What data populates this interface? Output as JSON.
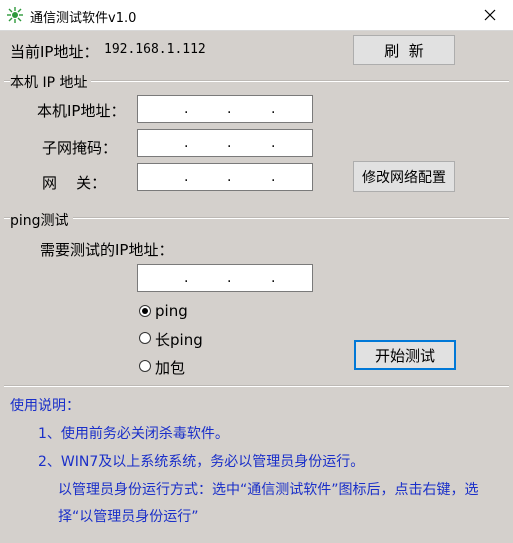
{
  "window": {
    "title": "通信测试软件v1.0",
    "icon": "network-icon"
  },
  "current_ip": {
    "label": "当前IP地址：",
    "value": "192.168.1.112",
    "refresh_label": "刷  新"
  },
  "local": {
    "section_title": "本机 IP 地址",
    "ip_label": "本机IP地址：",
    "mask_label": "子网掩码：",
    "gateway_label": "网    关：",
    "dot": ".",
    "modify_label": "修改网络配置"
  },
  "ping": {
    "section_title": "ping测试",
    "target_label": "需要测试的IP地址：",
    "options": [
      "ping",
      "长ping",
      "加包"
    ],
    "selected": "ping",
    "start_label": "开始测试"
  },
  "instructions": {
    "title": "使用说明：",
    "line1": "1、使用前务必关闭杀毒软件。",
    "line2": "2、WIN7及以上系统系统，务必以管理员身份运行。",
    "line3": "以管理员身份运行方式：选中“通信测试软件”图标后，点击右键，选",
    "line4": "择“以管理员身份运行”"
  },
  "colors": {
    "background": "#d4d0cc",
    "instruction_text": "#1a2fc9",
    "focus": "#0078d7"
  }
}
